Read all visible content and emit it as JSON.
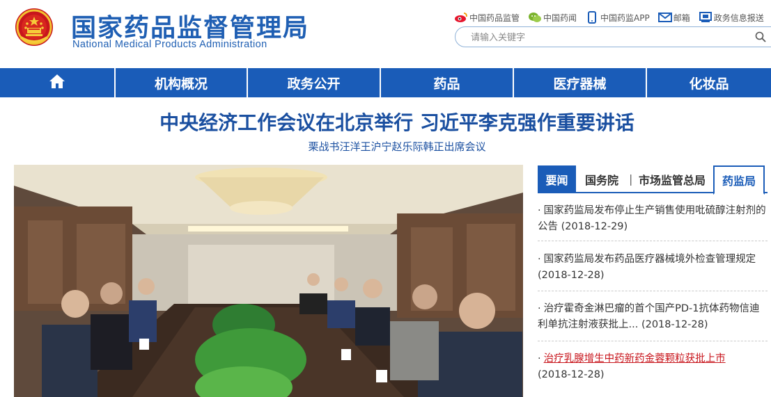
{
  "header": {
    "title_cn": "国家药品监督管理局",
    "title_en": "National Medical Products Administration"
  },
  "toplinks": [
    {
      "label": "中国药品监管",
      "icon": "weibo-icon"
    },
    {
      "label": "中国药闻",
      "icon": "wechat-icon"
    },
    {
      "label": "中国药监APP",
      "icon": "mobile-icon"
    },
    {
      "label": "邮箱",
      "icon": "mail-icon"
    },
    {
      "label": "政务信息报送",
      "icon": "monitor-icon"
    }
  ],
  "search": {
    "placeholder": "请输入关键字",
    "icon": "search-icon"
  },
  "nav": {
    "home_icon": "home-icon",
    "items": [
      "机构概况",
      "政务公开",
      "药品",
      "医疗器械",
      "化妆品"
    ]
  },
  "headline": {
    "title": "中央经济工作会议在北京举行 习近平李克强作重要讲话",
    "subtitle": "栗战书汪洋王沪宁赵乐际韩正出席会议"
  },
  "tabs": {
    "items": [
      "要闻",
      "国务院",
      "市场监管总局",
      "药监局"
    ],
    "separator": "|"
  },
  "news": [
    {
      "title": "国家药监局发布停止生产销售使用吡硫醇注射剂的公告",
      "date": "(2018-12-29)"
    },
    {
      "title": "国家药监局发布药品医疗器械境外检查管理规定",
      "date": "(2018-12-28)"
    },
    {
      "title": "治疗霍奇金淋巴瘤的首个国产PD-1抗体药物信迪利单抗注射液获批上...",
      "date": "(2018-12-28)"
    },
    {
      "title": "治疗乳腺增生中药新药金蓉颗粒获批上市",
      "date": "(2018-12-28)"
    }
  ],
  "colors": {
    "brand_blue": "#1a5cb8",
    "title_blue": "#1f5fb3",
    "link_red": "#c8161d"
  }
}
